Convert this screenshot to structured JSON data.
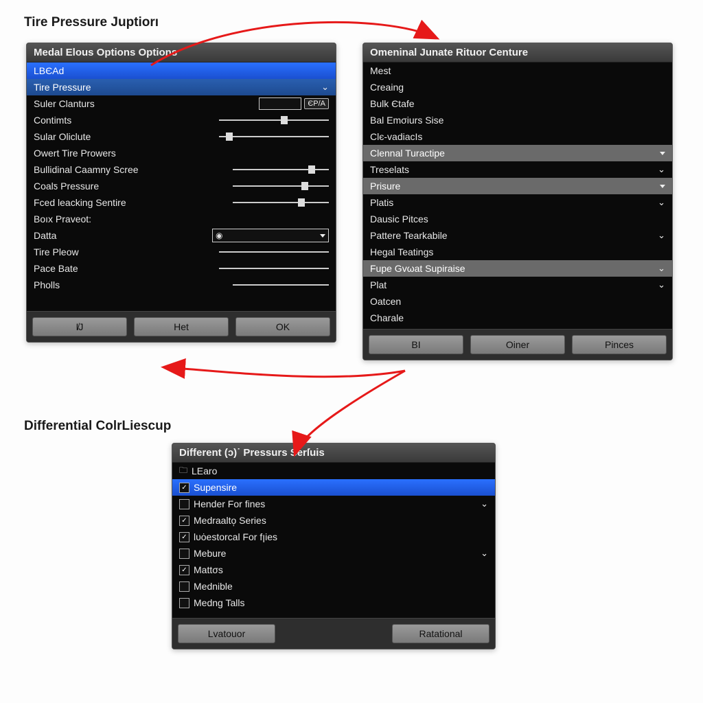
{
  "headings": {
    "top": "Tire Pressure Juptiorı",
    "bottom": "Differential ColrLiescup"
  },
  "colors": {
    "accent": "#2a70ff",
    "arrow": "#e61919"
  },
  "panel1": {
    "title": "Medal Elous Options Options",
    "rows": [
      {
        "label": "LВЄAd"
      },
      {
        "label": "Tire Pressure"
      },
      {
        "label": "Suler Clanturs"
      },
      {
        "label": "Contimts"
      },
      {
        "label": "Sular Oliclute"
      },
      {
        "label": "Owert Tire Prowers"
      },
      {
        "label": "Bullidinal Caamny Scree"
      },
      {
        "label": "Coalƽ Pressure"
      },
      {
        "label": "Fced leacking Sentire"
      },
      {
        "label": "Boıx Praveot:"
      },
      {
        "label": "Datta"
      },
      {
        "label": "Tire Pleow"
      },
      {
        "label": "Pace Bate"
      },
      {
        "label": "Pholls"
      }
    ],
    "chip": "ЄP/A",
    "dropdown_glyph": "◉",
    "buttons": [
      "I̸J",
      "Het",
      "OK"
    ]
  },
  "panel2": {
    "title": "Omeninal Junate Rituor Centure",
    "rows": [
      {
        "label": "Mest"
      },
      {
        "label": "Creaing"
      },
      {
        "label": "Bulk Єtafe"
      },
      {
        "label": "Bal Emσiurs Sise"
      },
      {
        "label": "Clє-vadiacIs"
      },
      {
        "label": "Clennal Turactipe"
      },
      {
        "label": "Treselats"
      },
      {
        "label": "Prisure"
      },
      {
        "label": "Platis"
      },
      {
        "label": "Dausic Pitces"
      },
      {
        "label": "Pattere Tearkabile"
      },
      {
        "label": "Hegal Teatings"
      },
      {
        "label": "Fupe Gvωat Supiraise"
      },
      {
        "label": "Plat"
      },
      {
        "label": "Oatcen"
      },
      {
        "label": "Charale"
      }
    ],
    "buttons": [
      "BI",
      "Oiner",
      "Pinces"
    ]
  },
  "panel3": {
    "title": "Different (ɔ)˙ Pressurs Serſuis",
    "items": [
      {
        "label": "LEaro",
        "icon": true,
        "checked": false
      },
      {
        "label": "Supensire",
        "checked": true,
        "highlight": true
      },
      {
        "label": "Hender For fines",
        "checked": false,
        "tick": true
      },
      {
        "label": "Medraalto͎ Series",
        "checked": true
      },
      {
        "label": "lυȯestorcal For fꞁies",
        "checked": true
      },
      {
        "label": "Mebure",
        "checked": false,
        "tick": true
      },
      {
        "label": "Mattσs",
        "checked": true
      },
      {
        "label": "Mednible",
        "checked": false
      },
      {
        "label": "Medng Talls",
        "checked": false
      }
    ],
    "buttons": [
      "Lvatouor",
      "Ratational"
    ]
  }
}
